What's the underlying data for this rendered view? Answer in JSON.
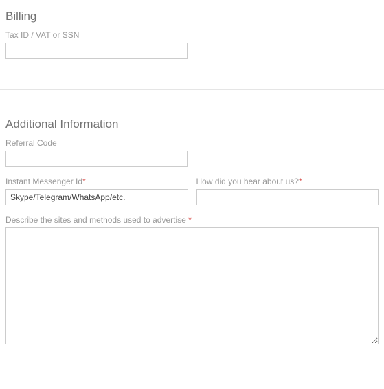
{
  "billing": {
    "title": "Billing",
    "tax_label": "Tax ID / VAT or SSN",
    "tax_value": ""
  },
  "additional": {
    "title": "Additional Information",
    "referral_label": "Referral Code",
    "referral_value": "",
    "im_label": "Instant Messenger Id",
    "im_placeholder": "Skype/Telegram/WhatsApp/etc.",
    "im_value": "",
    "hear_label": "How did you hear about us?",
    "hear_value": "",
    "describe_label": "Describe the sites and methods used to advertise ",
    "describe_value": "",
    "required_mark": "*"
  }
}
